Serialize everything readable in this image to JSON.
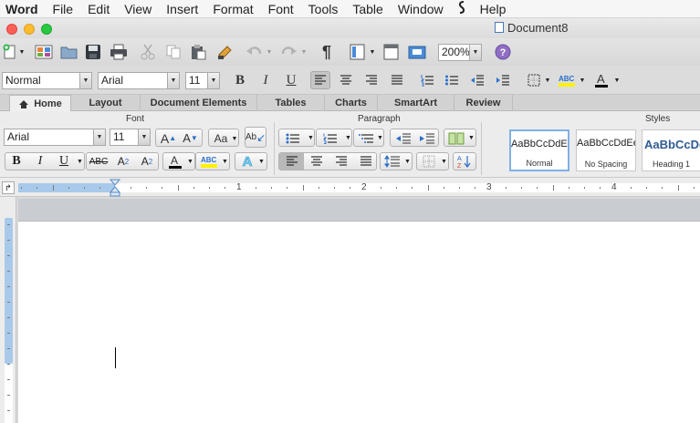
{
  "menubar": {
    "app": "Word",
    "items": [
      "File",
      "Edit",
      "View",
      "Insert",
      "Format",
      "Font",
      "Tools",
      "Table",
      "Window",
      "Help"
    ]
  },
  "window": {
    "title": "Document8"
  },
  "toolbar": {
    "zoom": "200%"
  },
  "formatting": {
    "style": "Normal",
    "font": "Arial",
    "size": "11"
  },
  "tabs": [
    "Home",
    "Layout",
    "Document Elements",
    "Tables",
    "Charts",
    "SmartArt",
    "Review"
  ],
  "ribbon": {
    "font_group_label": "Font",
    "paragraph_group_label": "Paragraph",
    "styles_group_label": "Styles",
    "font": "Arial",
    "size": "11",
    "styles": [
      {
        "preview": "AaBbCcDdEe",
        "name": "Normal"
      },
      {
        "preview": "AaBbCcDdEe",
        "name": "No Spacing"
      },
      {
        "preview": "AaBbCcDd",
        "name": "Heading 1"
      }
    ]
  },
  "ruler": {
    "numbers": [
      "1",
      "2",
      "3",
      "4"
    ]
  },
  "colors": {
    "font_color": "#000000",
    "highlight_color": "#fff200",
    "accent": "#4a90d9"
  }
}
